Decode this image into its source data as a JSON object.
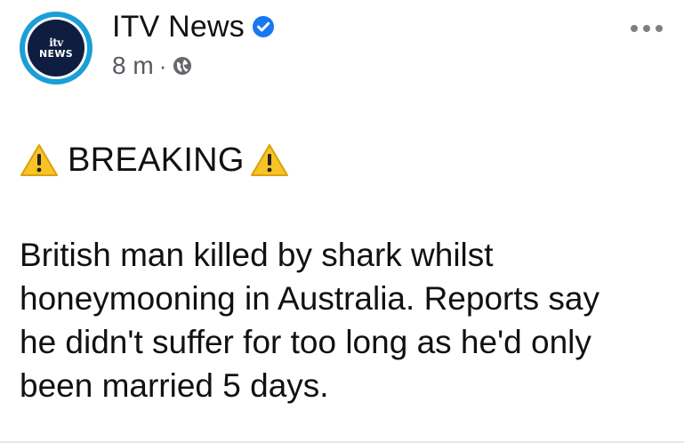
{
  "post": {
    "author": {
      "name": "ITV News",
      "avatar_logo_text": "itv",
      "avatar_sub_text": "NEWS",
      "verified": true,
      "verified_icon": "verified-badge-icon",
      "brand_color": "#1a9fd6",
      "avatar_bg_color": "#0f1d40"
    },
    "timestamp": "8 m",
    "separator": "·",
    "audience_icon": "globe-icon",
    "more_icon": "more-options-icon",
    "headline": {
      "label": "BREAKING",
      "icon": "warning-icon",
      "icon_color": "#f7c325"
    },
    "body_lines": [
      "British man killed by shark whilst",
      "honeymooning in Australia. Reports say",
      "he didn't suffer for too long as he'd only",
      "been married 5 days."
    ]
  }
}
